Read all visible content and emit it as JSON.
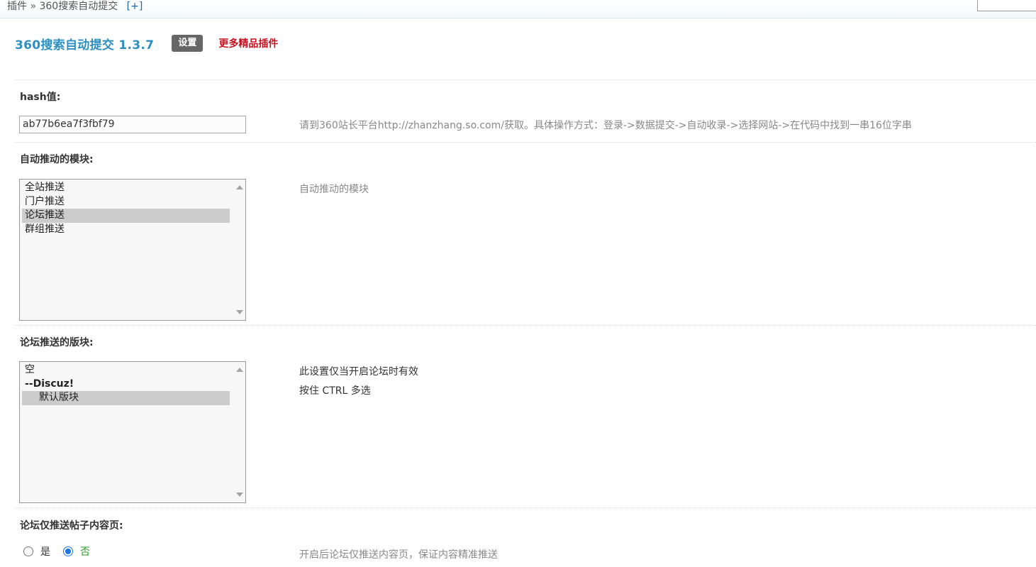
{
  "breadcrumb": {
    "root": "插件",
    "separator": "»",
    "current": "360搜索自动提交",
    "expand": "[+]"
  },
  "header": {
    "title": "360搜索自动提交 1.3.7",
    "settings_tab": "设置",
    "more_link": "更多精品插件"
  },
  "fields": {
    "hash": {
      "label": "hash值:",
      "value": "ab77b6ea7f3fbf79",
      "tip": "请到360站长平台http://zhanzhang.so.com/获取。具体操作方式：登录->数据提交->自动收录->选择网站->在代码中找到一串16位字串"
    },
    "modules": {
      "label": "自动推动的模块:",
      "options": [
        "全站推送",
        "门户推送",
        "论坛推送",
        "群组推送"
      ],
      "selected_index": 2,
      "tip": "自动推动的模块"
    },
    "forums": {
      "label": "论坛推送的版块:",
      "options": [
        "空",
        "--Discuz!",
        "默认版块"
      ],
      "selected_index": 2,
      "tip_line1": "此设置仅当开启论坛时有效",
      "tip_line2": "按住 CTRL 多选"
    },
    "content_only": {
      "label": "论坛仅推送帖子内容页:",
      "yes_label": "是",
      "no_label": "否",
      "selected": "no",
      "tip": "开启后论坛仅推送内容页，保证内容精准推送"
    }
  },
  "colors": {
    "title": "#2b8fc0",
    "more_link": "#c8101e",
    "settings_tab_bg": "#666666",
    "radio_checked": "#1a73e8",
    "radio_on_label": "#2a9d2a"
  }
}
